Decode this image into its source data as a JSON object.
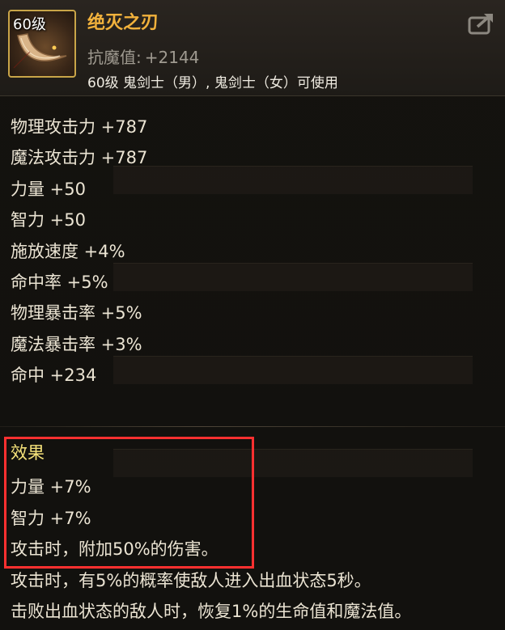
{
  "item": {
    "level_badge": "60级",
    "name": "绝灭之刃",
    "resist_label": "抗魔值:",
    "resist_value": "+2144",
    "usable_by": "60级 鬼剑士（男）, 鬼剑士（女）可使用",
    "icon": "curved-blade-icon"
  },
  "actions": {
    "share_icon": "share-export-icon"
  },
  "stats": [
    "物理攻击力 +787",
    "魔法攻击力 +787",
    "力量 +50",
    "智力 +50",
    "施放速度 +4%",
    "命中率 +5%",
    "物理暴击率 +5%",
    "魔法暴击率 +3%",
    "命中 +234"
  ],
  "effect": {
    "title": "效果",
    "lines": [
      "力量 +7%",
      "智力 +7%",
      "攻击时，附加50%的伤害。",
      "攻击时，有5%的概率使敌人进入出血状态5秒。",
      "击败出血状态的敌人时，恢复1%的生命值和魔法值。"
    ]
  },
  "colors": {
    "item_name": "#f2b23c",
    "effect_title": "#f5e27a",
    "icon_border": "#c9a548",
    "highlight": "#ff3030"
  }
}
